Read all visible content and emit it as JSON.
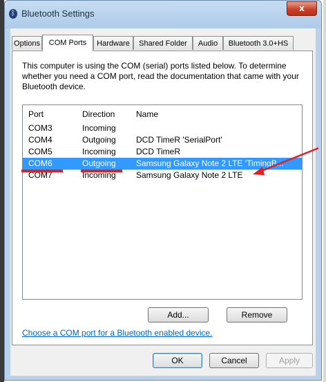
{
  "window": {
    "title": "Bluetooth Settings",
    "icon": "bluetooth-icon",
    "close_glyph": "x"
  },
  "tabs": [
    {
      "label": "Options"
    },
    {
      "label": "COM Ports",
      "active": true
    },
    {
      "label": "Hardware"
    },
    {
      "label": "Shared Folder"
    },
    {
      "label": "Audio"
    },
    {
      "label": "Bluetooth 3.0+HS"
    }
  ],
  "panel": {
    "intro": "This computer is using the COM (serial) ports listed below. To determine whether you need a COM port, read the documentation that came with your Bluetooth device.",
    "columns": {
      "port": "Port",
      "direction": "Direction",
      "name": "Name"
    },
    "rows": [
      {
        "port": "COM3",
        "direction": "Incoming",
        "name": ""
      },
      {
        "port": "COM4",
        "direction": "Outgoing",
        "name": "DCD TimeR 'SerialPort'"
      },
      {
        "port": "COM5",
        "direction": "Incoming",
        "name": "DCD TimeR"
      },
      {
        "port": "COM6",
        "direction": "Outgoing",
        "name": "Samsung Galaxy Note 2 LTE 'TimingB...",
        "selected": true
      },
      {
        "port": "COM7",
        "direction": "Incoming",
        "name": "Samsung Galaxy Note 2 LTE"
      }
    ],
    "add_label": "Add...",
    "remove_label": "Remove",
    "link_text": "Choose a COM port for a Bluetooth enabled device."
  },
  "footer": {
    "ok_label": "OK",
    "cancel_label": "Cancel",
    "apply_label": "Apply"
  },
  "colors": {
    "selection": "#3399ff",
    "annotation": "#e02020",
    "link": "#0066cc"
  }
}
